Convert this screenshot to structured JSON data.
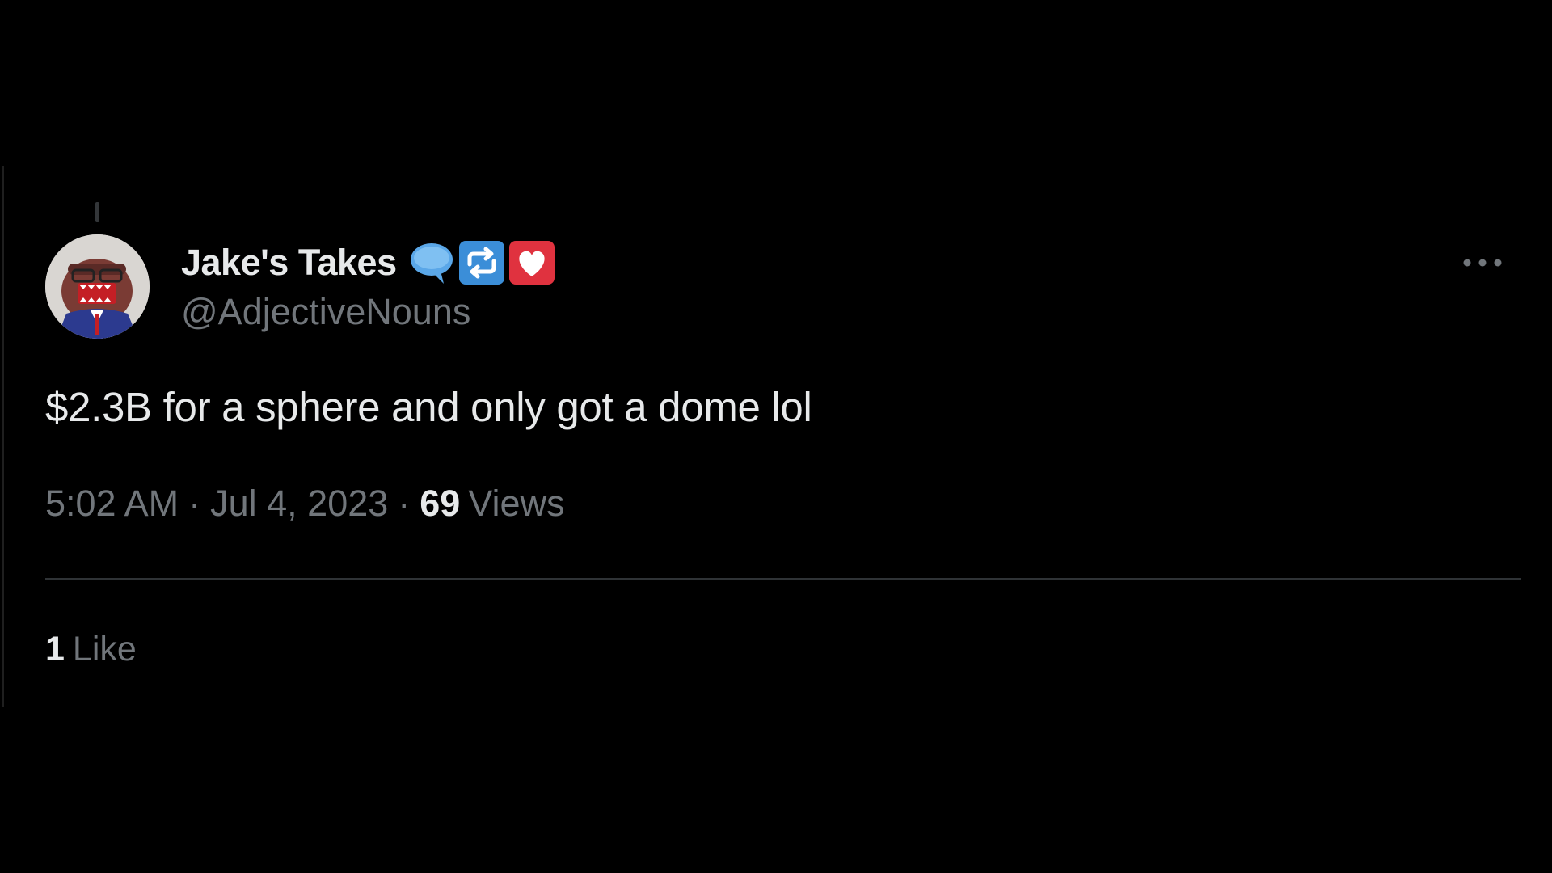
{
  "tweet": {
    "display_name": "Jake's Takes",
    "badges": [
      "speech-bubble-icon",
      "repeat-icon",
      "heart-icon"
    ],
    "handle": "@AdjectiveNouns",
    "text": "$2.3B for a sphere and only got a dome lol",
    "time": "5:02 AM",
    "date": "Jul 4, 2023",
    "separator": "·",
    "views_count": "69",
    "views_label": "Views",
    "likes_count": "1",
    "likes_label": "Like"
  },
  "colors": {
    "background": "#000000",
    "primary_text": "#e7e9ea",
    "secondary_text": "#71767b",
    "divider": "#2f3336",
    "badge_blue": "#3b8ed8",
    "badge_red": "#e0323f"
  }
}
